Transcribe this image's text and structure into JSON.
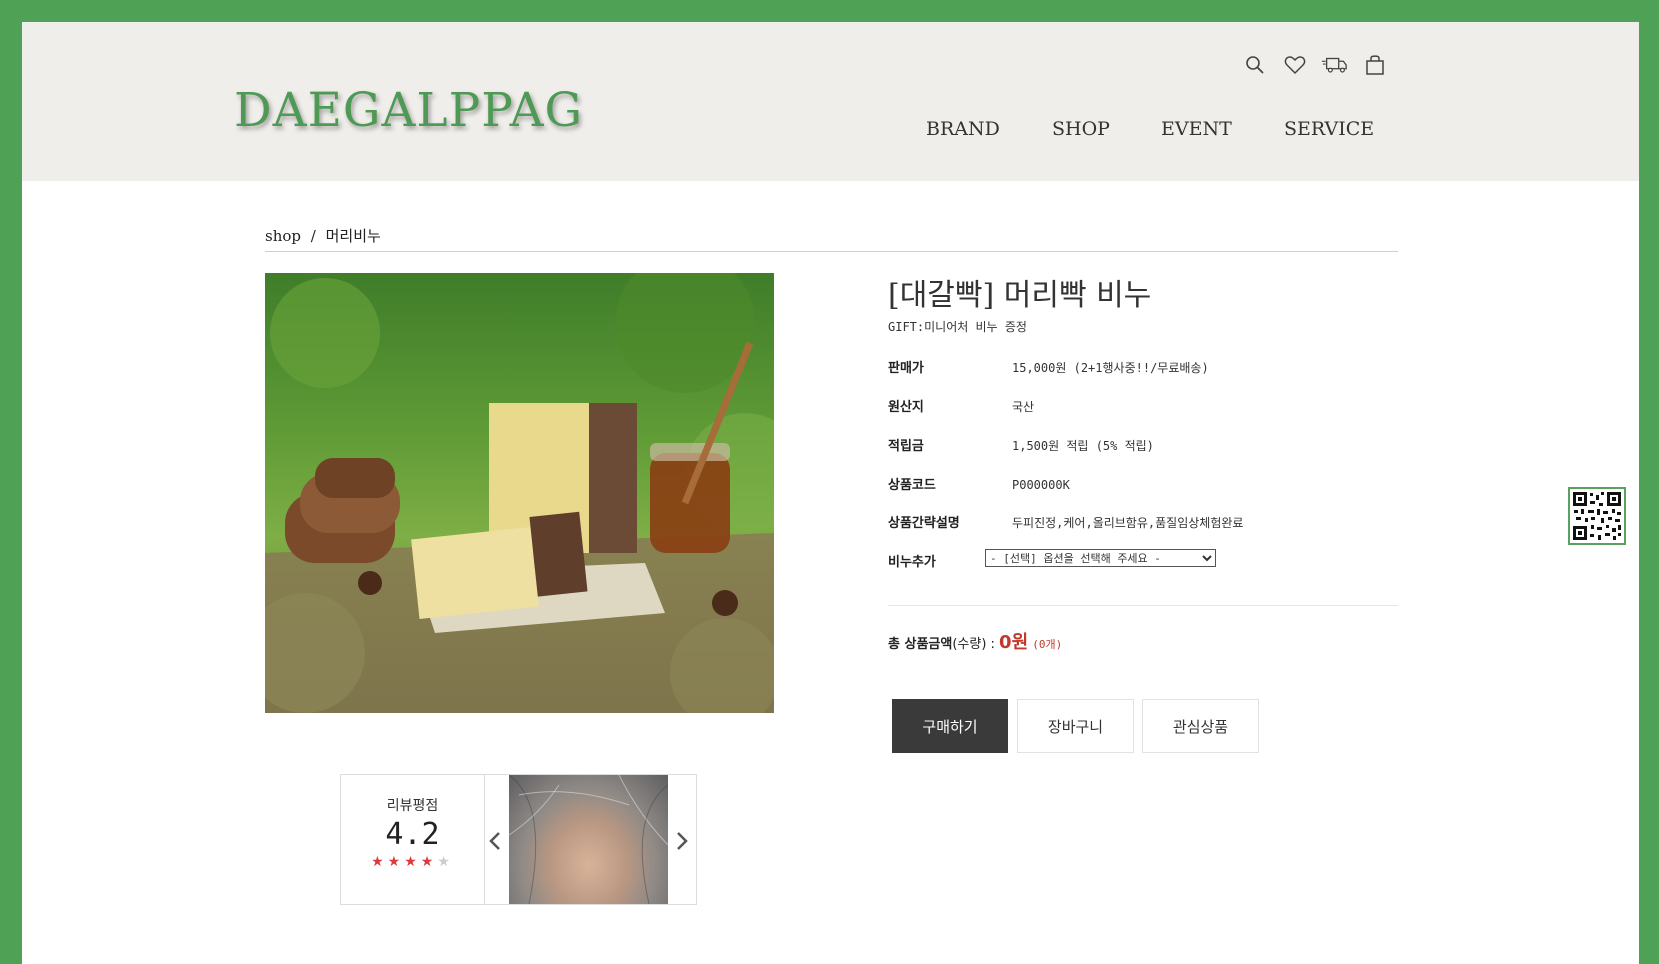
{
  "brand": {
    "logo_text": "DAEGALPPAG"
  },
  "header_icons": [
    "search-icon",
    "heart-icon",
    "delivery-truck-icon",
    "shopping-bag-icon"
  ],
  "nav": [
    "BRAND",
    "SHOP",
    "EVENT",
    "SERVICE"
  ],
  "breadcrumb": {
    "root": "shop",
    "separator": "/",
    "current": "머리비누"
  },
  "product": {
    "title": "[대갈빡] 머리빡 비누",
    "gift": "GIFT:미니어처 비누 증정",
    "rows": [
      {
        "label": "판매가",
        "value": "15,000원 (2+1행사중!!/무료배송)"
      },
      {
        "label": "원산지",
        "value": "국산"
      },
      {
        "label": "적립금",
        "value": "1,500원 적립 (5% 적립)"
      },
      {
        "label": "상품코드",
        "value": "P000000K"
      },
      {
        "label": "상품간략설명",
        "value": "두피진정,케어,올리브함유,품질임상체험완료"
      }
    ],
    "option": {
      "label": "비누추가",
      "selected": "- [선택] 옵션을 선택해 주세요 -"
    }
  },
  "total": {
    "label": "총 상품금액",
    "qty_label": "(수량) :",
    "price": "0원",
    "qty": "(0개)"
  },
  "buttons": {
    "buy": "구매하기",
    "cart": "장바구니",
    "wish": "관심상품"
  },
  "review": {
    "label": "리뷰평점",
    "score": "4.2",
    "stars_filled": 4,
    "stars_total": 5
  },
  "colors": {
    "frame_green": "#4ea155",
    "logo_green": "#4e9a55",
    "header_bg": "#f0eeeb",
    "price_red": "#c0392b",
    "buy_button": "#3a3a3a"
  }
}
